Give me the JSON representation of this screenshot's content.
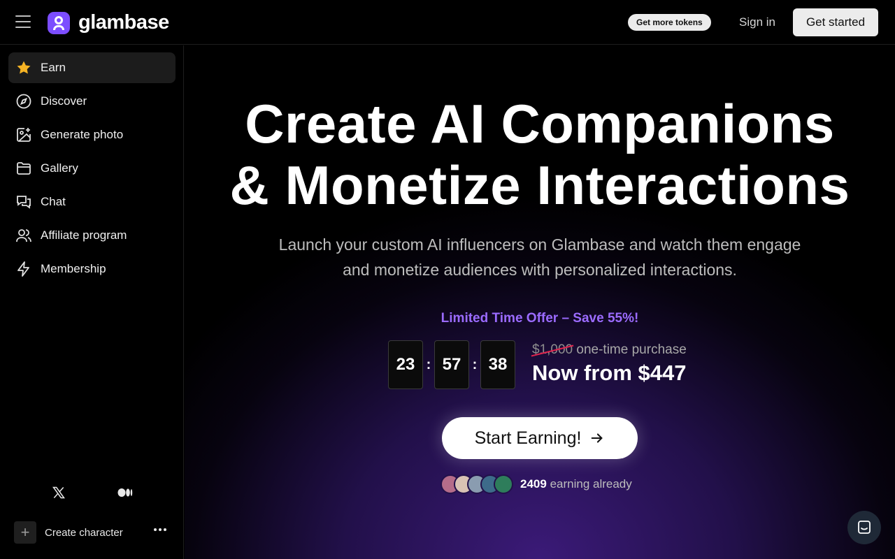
{
  "brand": {
    "name": "glambase",
    "accent": "#7c4dff"
  },
  "header": {
    "tokens_label": "Get more tokens",
    "signin_label": "Sign in",
    "get_started_label": "Get started"
  },
  "sidebar": {
    "items": [
      {
        "label": "Earn",
        "icon": "star-icon",
        "active": true
      },
      {
        "label": "Discover",
        "icon": "compass-icon"
      },
      {
        "label": "Generate photo",
        "icon": "image-plus-icon"
      },
      {
        "label": "Gallery",
        "icon": "folder-icon"
      },
      {
        "label": "Chat",
        "icon": "chat-icon"
      },
      {
        "label": "Affiliate program",
        "icon": "users-icon"
      },
      {
        "label": "Membership",
        "icon": "lightning-icon"
      }
    ],
    "social": [
      "x-icon",
      "medium-icon"
    ],
    "create_label": "Create character"
  },
  "hero": {
    "title_line1": "Create AI Companions",
    "title_line2": "& Monetize Interactions",
    "subtitle": "Launch your custom AI influencers on Glambase and watch them engage and monetize audiences with personalized interactions.",
    "offer": "Limited Time Offer – Save 55%!",
    "timer": {
      "hours": "23",
      "minutes": "57",
      "seconds": "38"
    },
    "price_old": "$1,000",
    "price_old_suffix": "one-time purchase",
    "price_now": "Now from $447",
    "cta_label": "Start Earning!",
    "earning_count": "2409",
    "earning_suffix": "earning already"
  },
  "colors": {
    "offer": "#9b6bff",
    "strike": "#e0244e",
    "avatars": [
      "#b56c8a",
      "#d9c2b4",
      "#8a9cb0",
      "#3d6b8a",
      "#2e7d5b"
    ]
  }
}
